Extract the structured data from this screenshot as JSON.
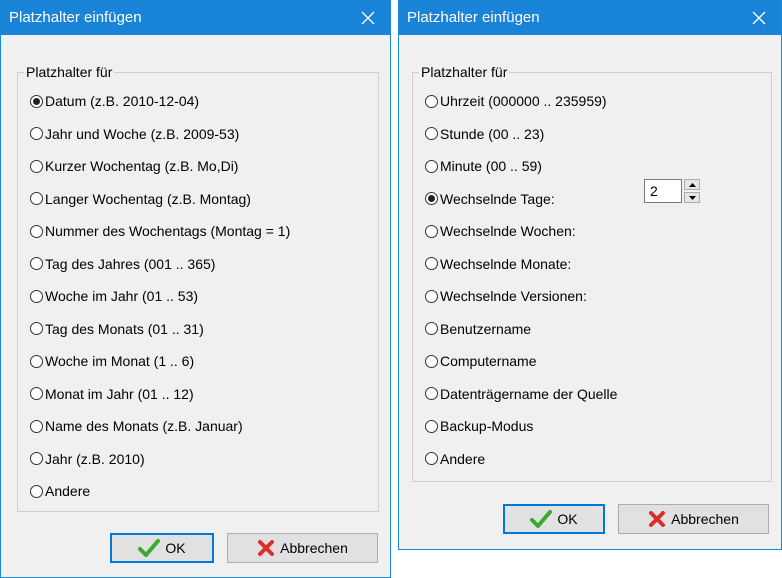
{
  "left_dialog": {
    "title": "Platzhalter einfügen",
    "group_label": "Platzhalter für",
    "options": [
      {
        "label": "Datum (z.B. 2010-12-04)",
        "checked": true
      },
      {
        "label": "Jahr und Woche (z.B. 2009-53)",
        "checked": false
      },
      {
        "label": "Kurzer Wochentag (z.B. Mo,Di)",
        "checked": false
      },
      {
        "label": "Langer Wochentag (z.B. Montag)",
        "checked": false
      },
      {
        "label": "Nummer des Wochentags (Montag = 1)",
        "checked": false
      },
      {
        "label": "Tag des Jahres (001 .. 365)",
        "checked": false
      },
      {
        "label": "Woche im Jahr (01 .. 53)",
        "checked": false
      },
      {
        "label": "Tag des Monats (01 .. 31)",
        "checked": false
      },
      {
        "label": "Woche im Monat (1 .. 6)",
        "checked": false
      },
      {
        "label": "Monat im Jahr (01 .. 12)",
        "checked": false
      },
      {
        "label": "Name des Monats (z.B. Januar)",
        "checked": false
      },
      {
        "label": "Jahr (z.B. 2010)",
        "checked": false
      },
      {
        "label": "Andere",
        "checked": false
      }
    ],
    "ok_label": "OK",
    "cancel_label": "Abbrechen"
  },
  "right_dialog": {
    "title": "Platzhalter einfügen",
    "group_label": "Platzhalter für",
    "options": [
      {
        "label": "Uhrzeit (000000 .. 235959)",
        "checked": false
      },
      {
        "label": "Stunde (00 .. 23)",
        "checked": false
      },
      {
        "label": "Minute (00 .. 59)",
        "checked": false
      },
      {
        "label": "Wechselnde Tage:",
        "checked": true
      },
      {
        "label": "Wechselnde Wochen:",
        "checked": false
      },
      {
        "label": "Wechselnde Monate:",
        "checked": false
      },
      {
        "label": "Wechselnde Versionen:",
        "checked": false
      },
      {
        "label": "Benutzername",
        "checked": false
      },
      {
        "label": "Computername",
        "checked": false
      },
      {
        "label": "Datenträgername der Quelle",
        "checked": false
      },
      {
        "label": "Backup-Modus",
        "checked": false
      },
      {
        "label": "Andere",
        "checked": false
      }
    ],
    "spin_value": "2",
    "ok_label": "OK",
    "cancel_label": "Abbrechen"
  },
  "icons": {
    "close": "close-icon",
    "ok": "checkmark-icon",
    "cancel": "red-x-icon",
    "spin_up": "arrow-up-icon",
    "spin_down": "arrow-down-icon"
  },
  "colors": {
    "titlebar": "#1883d7",
    "window_bg": "#f0f0f0",
    "default_button_border": "#0078d7",
    "checkmark": "#3aa832",
    "cancel_x": "#d9302a"
  }
}
